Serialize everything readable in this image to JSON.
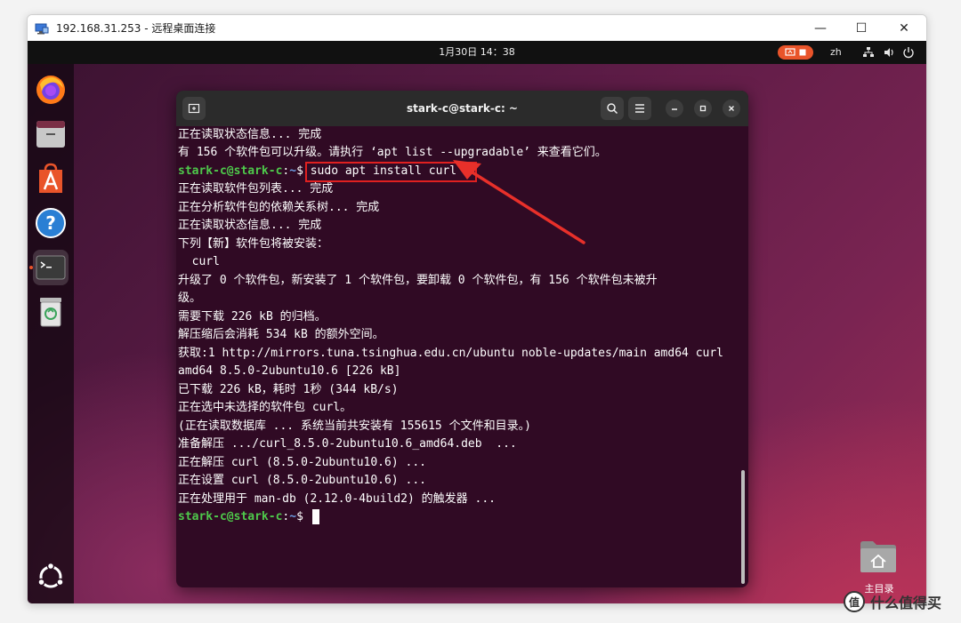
{
  "rdp": {
    "title": "192.168.31.253 - 远程桌面连接",
    "minimize_glyph": "—",
    "maximize_glyph": "☐",
    "close_glyph": "✕"
  },
  "topbar": {
    "clock": "1月30日  14：38",
    "language": "zh"
  },
  "dock": {
    "items": [
      {
        "name": "firefox-icon"
      },
      {
        "name": "files-icon"
      },
      {
        "name": "app-center-icon"
      },
      {
        "name": "help-icon"
      },
      {
        "name": "terminal-icon"
      },
      {
        "name": "trash-icon"
      },
      {
        "name": "show-apps-icon"
      }
    ]
  },
  "terminal": {
    "title": "stark-c@stark-c: ~",
    "prompt_user": "stark-c@stark-c",
    "prompt_sep": ":",
    "prompt_path": "~",
    "prompt_end": "$ ",
    "command": "sudo apt install curl",
    "lines": [
      "正在读取状态信息... 完成",
      "有 156 个软件包可以升级。请执行 ‘apt list --upgradable’ 来查看它们。",
      "正在读取软件包列表... 完成",
      "正在分析软件包的依赖关系树... 完成",
      "正在读取状态信息... 完成",
      "下列【新】软件包将被安装：",
      "  curl",
      "升级了 0 个软件包，新安装了 1 个软件包，要卸载 0 个软件包，有 156 个软件包未被升",
      "级。",
      "需要下载 226 kB 的归档。",
      "解压缩后会消耗 534 kB 的额外空间。",
      "获取:1 http://mirrors.tuna.tsinghua.edu.cn/ubuntu noble-updates/main amd64 curl",
      "amd64 8.5.0-2ubuntu10.6 [226 kB]",
      "已下载 226 kB，耗时 1秒 (344 kB/s)",
      "正在选中未选择的软件包 curl。",
      "(正在读取数据库 ... 系统当前共安装有 155615 个文件和目录。)",
      "准备解压 .../curl_8.5.0-2ubuntu10.6_amd64.deb  ...",
      "正在解压 curl (8.5.0-2ubuntu10.6) ...",
      "正在设置 curl (8.5.0-2ubuntu10.6) ...",
      "正在处理用于 man-db (2.12.0-4build2) 的触发器 ..."
    ]
  },
  "desktop": {
    "home_label": "主目录"
  },
  "watermark": {
    "logo_text": "值",
    "text": "什么值得买"
  },
  "colors": {
    "terminal_bg": "#300a24",
    "prompt_user": "#4ec94b",
    "prompt_path": "#6d9fe6",
    "highlight": "#e02020",
    "ubuntu_orange": "#e9542a"
  }
}
